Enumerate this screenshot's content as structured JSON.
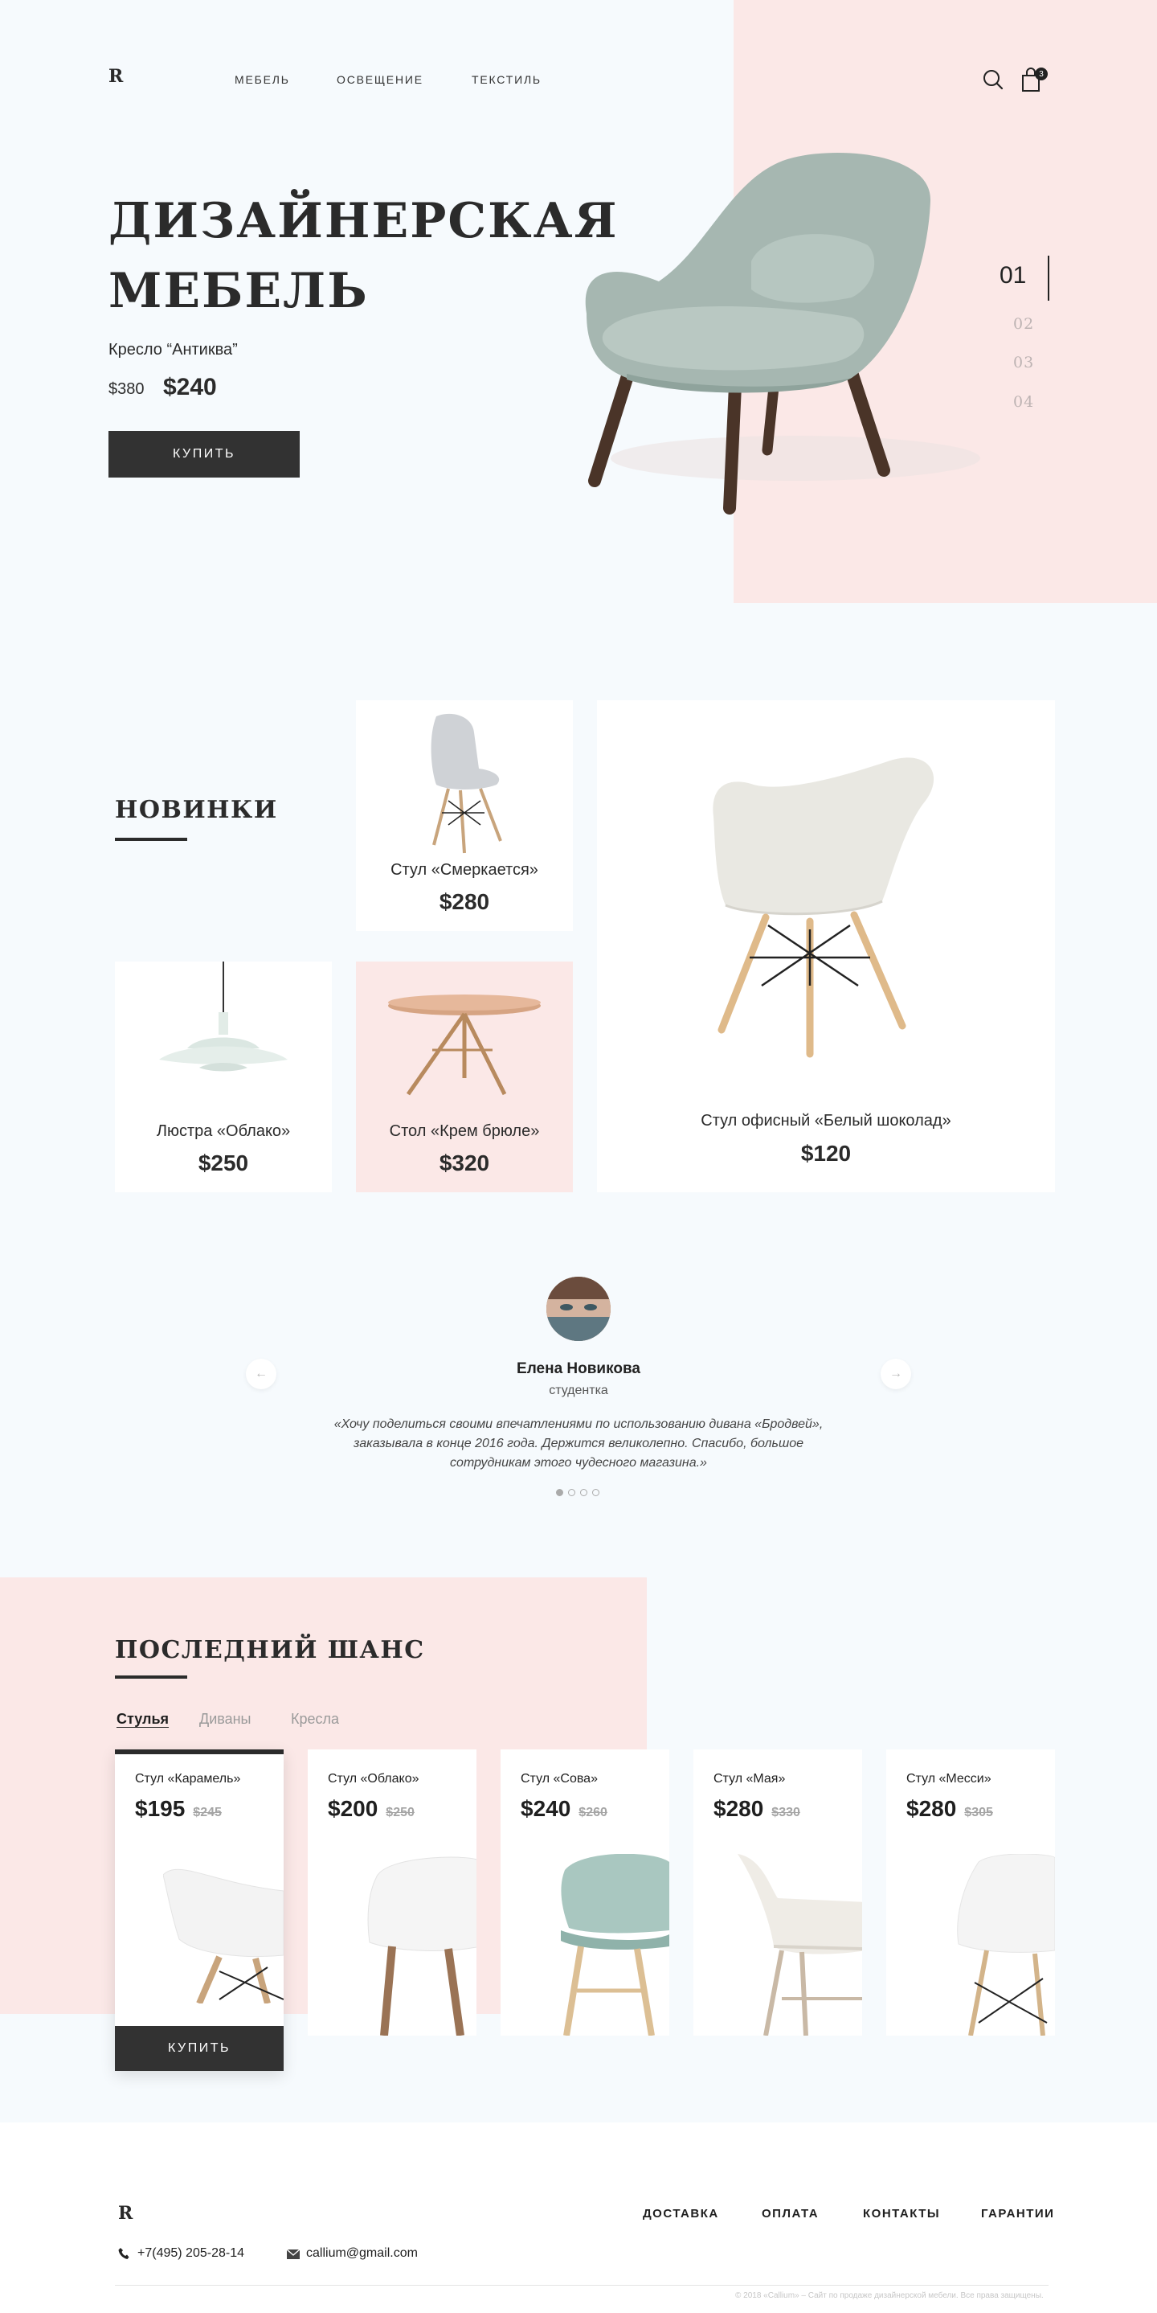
{
  "header": {
    "logo": "R",
    "nav": [
      "МЕБЕЛЬ",
      "ОСВЕЩЕНИЕ",
      "ТЕКСТИЛЬ"
    ],
    "cart_count": "3",
    "icons": [
      "search-icon",
      "bag-icon"
    ]
  },
  "hero": {
    "title_line1": "ДИЗАЙНЕРСКАЯ",
    "title_line2": "МЕБЕЛЬ",
    "product": "Кресло “Антиква”",
    "old_price": "$380",
    "price": "$240",
    "buy": "КУПИТЬ",
    "slides": [
      "01",
      "02",
      "03",
      "04"
    ],
    "active_slide": "01"
  },
  "new": {
    "title": "НОВИНКИ",
    "items": [
      {
        "name": "Стул «Смеркается»",
        "price": "$280"
      },
      {
        "name": "Стул офисный «Белый шоколад»",
        "price": "$120"
      },
      {
        "name": "Люстра «Облако»",
        "price": "$250"
      },
      {
        "name": "Стол «Крем брюле»",
        "price": "$320"
      }
    ]
  },
  "testimonial": {
    "name": "Елена Новикова",
    "role": "студентка",
    "quote_1": "«Хочу поделиться своими впечатлениями по использованию дивана «Бродвей»,",
    "quote_2": "заказывала в конце 2016 года. Держится великолепно. Спасибо, большое",
    "quote_3": "сотрудникам этого чудесного магазина.»",
    "prev": "←",
    "next": "→",
    "dots": 4,
    "active_dot": 0
  },
  "last_chance": {
    "title": "ПОСЛЕДНИЙ ШАНС",
    "tabs": [
      "Стулья",
      "Диваны",
      "Кресла"
    ],
    "active_tab": "Стулья",
    "buy": "КУПИТЬ",
    "products": [
      {
        "name": "Стул «Карамель»",
        "price": "$195",
        "old": "$245"
      },
      {
        "name": "Стул «Облако»",
        "price": "$200",
        "old": "$250"
      },
      {
        "name": "Стул «Сова»",
        "price": "$240",
        "old": "$260"
      },
      {
        "name": "Стул «Мая»",
        "price": "$280",
        "old": "$330"
      },
      {
        "name": "Стул «Месси»",
        "price": "$280",
        "old": "$305"
      }
    ]
  },
  "footer": {
    "logo": "R",
    "links": [
      "ДОСТАВКА",
      "ОПЛАТА",
      "КОНТАКТЫ",
      "ГАРАНТИИ"
    ],
    "phone": "+7(495) 205-28-14",
    "email": "callium@gmail.com",
    "copyright": "© 2018 «Callium» – Сайт по продаже дизайнерской мебели. Все права защищены."
  },
  "colors": {
    "pink": "#fbe8e7",
    "bg": "#f6fafd",
    "dark": "#323232",
    "mint": "#aab9b3"
  }
}
